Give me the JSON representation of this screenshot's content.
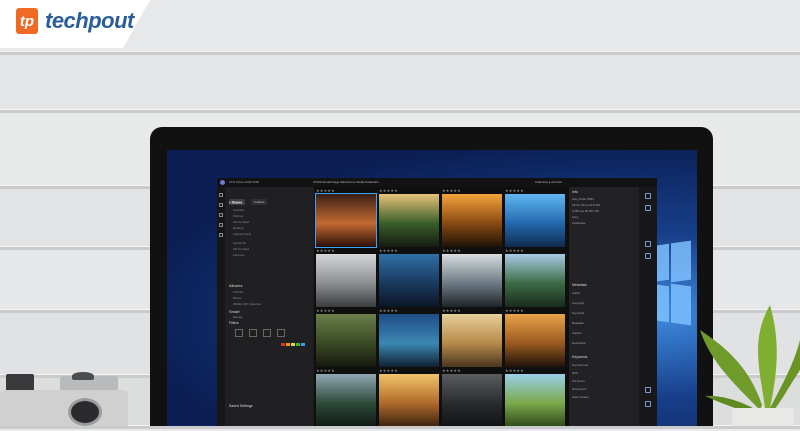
{
  "brand": {
    "mark": "tp",
    "name": "techpout",
    "color": "#f06a24",
    "text_color": "#2a5d9a"
  },
  "app": {
    "title": "ON1 Photo RAW 2018",
    "path": "ON1/Forland/Image Main/Home Studio/Collection",
    "topbar_right": "Collection ▸ All Gold",
    "left_tabs": [
      "Browse",
      "Folders"
    ],
    "sections": {
      "folders": "Folders",
      "albums": "Albums",
      "smart": "Smart",
      "filters": "Filters",
      "settings": "Saved Settings"
    },
    "folder_rows": [
      "Favorites",
      "Pictures",
      "ON1 Forland",
      "Desktop",
      "Captured Sets",
      "Search All",
      "ON1 Forland",
      "Favorites"
    ],
    "album_rows": [
      "Portfolio",
      "iPhone",
      "Wildlife WIP Collection"
    ],
    "smart_rows": [
      "Ratings"
    ],
    "accent_color": "#33a6ff"
  },
  "grid": {
    "stars": "★★★★★",
    "selected_index": 0,
    "thumbs": [
      {
        "name": "violinist",
        "colors": [
          "#3a1f14",
          "#c46a32",
          "#2a0f08"
        ]
      },
      {
        "name": "mountain-flowers",
        "colors": [
          "#e7c27a",
          "#3b5f2a",
          "#151a10"
        ]
      },
      {
        "name": "sunset-lake",
        "colors": [
          "#f4a23a",
          "#8a4a12",
          "#1e1207"
        ]
      },
      {
        "name": "blue-pool",
        "colors": [
          "#5fb7f0",
          "#2369b0",
          "#0f2b4c"
        ]
      },
      {
        "name": "foggy-mountains",
        "colors": [
          "#d4d6d8",
          "#8c8f92",
          "#3a3d40"
        ]
      },
      {
        "name": "night-rocks",
        "colors": [
          "#2f6fa8",
          "#1b3a5e",
          "#0a1526"
        ]
      },
      {
        "name": "beach-dusk",
        "colors": [
          "#d9dde0",
          "#6d7a84",
          "#1f2428"
        ]
      },
      {
        "name": "river-cliff",
        "colors": [
          "#a9cbe6",
          "#3d6b45",
          "#1a2b1d"
        ]
      },
      {
        "name": "forest-trail",
        "colors": [
          "#6b7e4a",
          "#3a4a26",
          "#15190e"
        ]
      },
      {
        "name": "glacier-lake",
        "colors": [
          "#1f4d86",
          "#3b88b3",
          "#102034"
        ]
      },
      {
        "name": "lighthouse",
        "colors": [
          "#e6cf9a",
          "#b88a4a",
          "#4a3620"
        ]
      },
      {
        "name": "hammock-tree",
        "colors": [
          "#e8a24a",
          "#9a5a20",
          "#20120a"
        ]
      },
      {
        "name": "waterfall",
        "colors": [
          "#8fa8b4",
          "#2e4a3a",
          "#101a14"
        ]
      },
      {
        "name": "golden-field",
        "colors": [
          "#f2c46a",
          "#b06a2a",
          "#3a2210"
        ]
      },
      {
        "name": "dark-pine",
        "colors": [
          "#5a5d60",
          "#2a2c2e",
          "#101112"
        ]
      },
      {
        "name": "meadow",
        "colors": [
          "#9acfe8",
          "#7aa84a",
          "#2e4a1a"
        ]
      }
    ]
  },
  "right_panel": {
    "rows": [
      "Sony ILCE-7RM3",
      "FE 24-70mm F2.8 GM",
      "1/250 sec  f/8  ISO 100",
      "Sony",
      "Landscape",
      "Author",
      "Copyright",
      "Keywords",
      "Metadata",
      "Caption",
      "Description",
      "Keyword List",
      "GPS",
      "File Name",
      "Dimensions",
      "Date Created"
    ],
    "labels": [
      "Info",
      "Metadata",
      "Keywords"
    ]
  }
}
